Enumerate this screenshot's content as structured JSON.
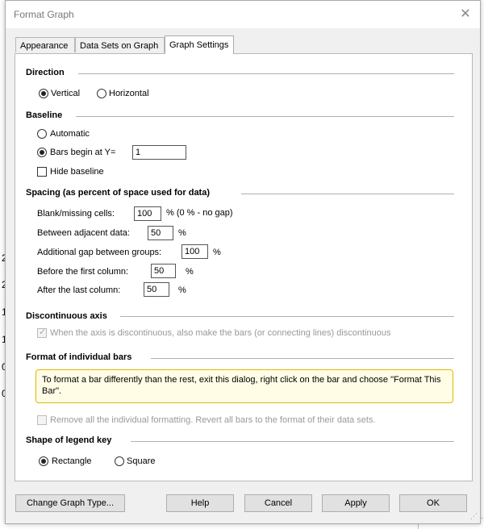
{
  "window": {
    "title": "Format Graph",
    "close_glyph": "✕"
  },
  "tabs": [
    {
      "label": "Appearance"
    },
    {
      "label": "Data Sets on Graph"
    },
    {
      "label": "Graph Settings"
    }
  ],
  "direction": {
    "heading": "Direction",
    "vertical": "Vertical",
    "horizontal": "Horizontal",
    "selected": "vertical"
  },
  "baseline": {
    "heading": "Baseline",
    "automatic": "Automatic",
    "bars_begin": "Bars begin at Y=",
    "bars_begin_value": "1",
    "hide": "Hide baseline"
  },
  "spacing": {
    "heading": "Spacing (as percent of space used for data)",
    "blank_label": "Blank/missing cells:",
    "blank_value": "100",
    "blank_suffix": "%  (0 % - no gap)",
    "adjacent_label": "Between adjacent data:",
    "adjacent_value": "50",
    "adjacent_suffix": "%",
    "groups_label": "Additional gap between groups:",
    "groups_value": "100",
    "groups_suffix": "%",
    "first_label": "Before the first column:",
    "first_value": "50",
    "first_suffix": "%",
    "last_label": "After the last column:",
    "last_value": "50",
    "last_suffix": "%"
  },
  "discontinuous": {
    "heading": "Discontinuous axis",
    "option": "When the axis is discontinuous, also make the bars (or connecting lines) discontinuous"
  },
  "individual": {
    "heading": "Format of individual bars",
    "note": "To format a bar differently than the rest, exit this dialog, right click on the bar and choose \"Format This Bar\".",
    "remove": "Remove all the individual formatting. Revert all bars to the format of their data sets."
  },
  "legend": {
    "heading": "Shape of legend key",
    "rectangle": "Rectangle",
    "square": "Square",
    "selected": "rectangle"
  },
  "buttons": {
    "change_type": "Change Graph Type...",
    "help": "Help",
    "cancel": "Cancel",
    "apply": "Apply",
    "ok": "OK"
  }
}
